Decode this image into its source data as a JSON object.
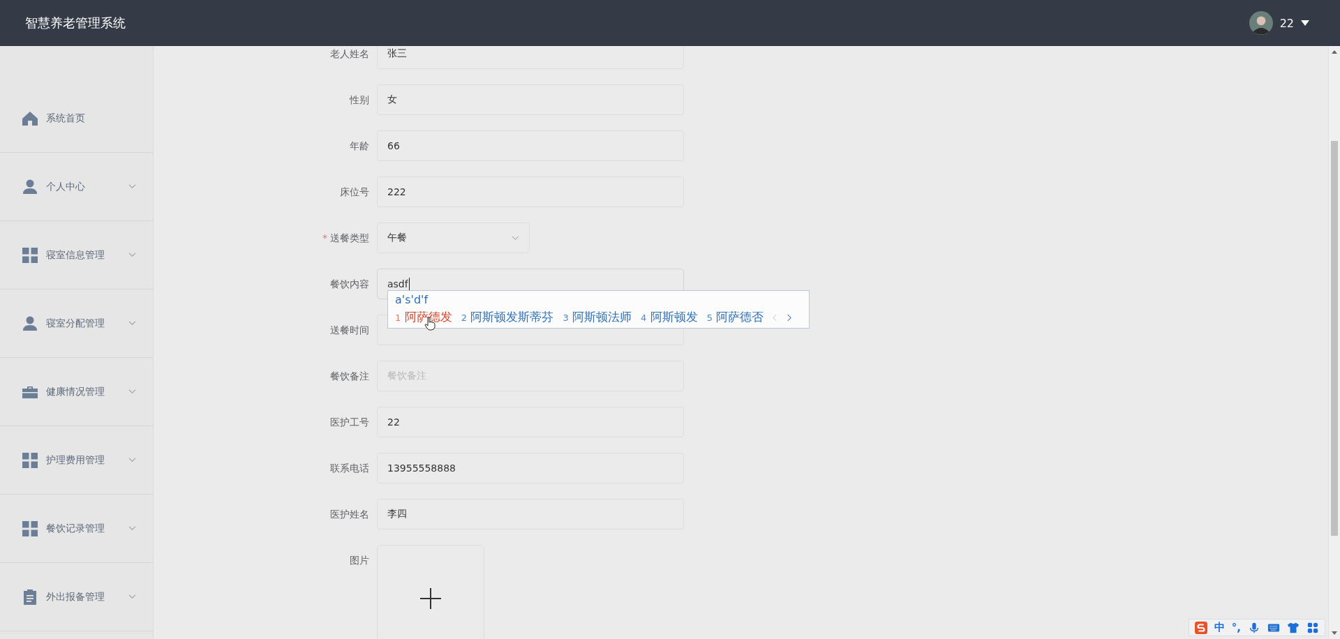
{
  "header": {
    "title": "智慧养老管理系统",
    "user": {
      "name": "22"
    }
  },
  "sidebar": {
    "items": [
      {
        "label": "系统首页",
        "kind": "home",
        "has_submenu": false
      },
      {
        "label": "个人中心",
        "kind": "person",
        "has_submenu": true
      },
      {
        "label": "寝室信息管理",
        "kind": "grid",
        "has_submenu": true
      },
      {
        "label": "寝室分配管理",
        "kind": "person",
        "has_submenu": true
      },
      {
        "label": "健康情况管理",
        "kind": "briefcase",
        "has_submenu": true
      },
      {
        "label": "护理费用管理",
        "kind": "grid",
        "has_submenu": true
      },
      {
        "label": "餐饮记录管理",
        "kind": "grid",
        "has_submenu": true
      },
      {
        "label": "外出报备管理",
        "kind": "clipboard",
        "has_submenu": true
      }
    ]
  },
  "form": {
    "fields": [
      {
        "label": "老人姓名",
        "kind": "input",
        "value": "张三",
        "focused": false
      },
      {
        "label": "性别",
        "kind": "input",
        "value": "女",
        "focused": false
      },
      {
        "label": "年龄",
        "kind": "input",
        "value": "66",
        "focused": false
      },
      {
        "label": "床位号",
        "kind": "input",
        "value": "222",
        "focused": false
      },
      {
        "label": "送餐类型",
        "kind": "select",
        "value": "午餐",
        "required_mark": "*"
      },
      {
        "label": "餐饮内容",
        "kind": "input",
        "value": "asdf",
        "focused": true
      },
      {
        "label": "送餐时间",
        "kind": "input",
        "focused": false
      },
      {
        "label": "餐饮备注",
        "kind": "input",
        "placeholder": "餐饮备注",
        "focused": false
      },
      {
        "label": "医护工号",
        "kind": "input",
        "value": "22",
        "focused": false
      },
      {
        "label": "联系电话",
        "kind": "input",
        "value": "13955558888",
        "focused": false
      },
      {
        "label": "医护姓名",
        "kind": "input",
        "value": "李四",
        "focused": false
      },
      {
        "label": "图片",
        "kind": "upload"
      }
    ]
  },
  "ime_popup": {
    "composition": "a's'd'f",
    "candidates": [
      {
        "index": "1",
        "text": "阿萨德发",
        "selected": true
      },
      {
        "index": "2",
        "text": "阿斯顿发斯蒂芬",
        "selected": false
      },
      {
        "index": "3",
        "text": "阿斯顿法师",
        "selected": false
      },
      {
        "index": "4",
        "text": "阿斯顿发",
        "selected": false
      },
      {
        "index": "5",
        "text": "阿萨德否",
        "selected": false
      }
    ]
  },
  "ime_toolbar": {
    "mode": "中",
    "punctuation": "°,"
  }
}
